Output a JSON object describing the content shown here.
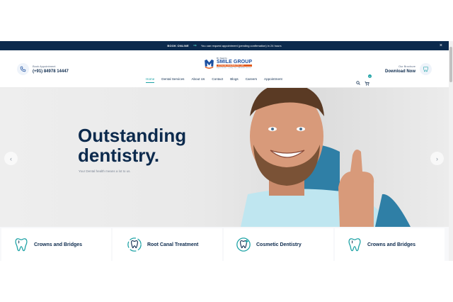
{
  "topbar": {
    "book_label": "BOOK ONLINE",
    "arrow": "⇒",
    "message": "You can request appointment (pending confirmation) in 24 hours",
    "close": "×"
  },
  "header": {
    "appointment": {
      "label": "Book Appointment",
      "phone": "(+91) 84978 14447"
    },
    "brochure": {
      "label": "Our Brochure",
      "link": "Download Now"
    },
    "logo": {
      "prefix": "Dr. Kaam's",
      "name": "SMILE GROUP",
      "sub": "of Dental Hospitals Pvt. Ltd.",
      "tagline": "Expert Doctors • Quality Care • Affordable Services"
    },
    "nav": [
      {
        "label": "Home",
        "active": true
      },
      {
        "label": "Dental Services",
        "active": false
      },
      {
        "label": "About Us",
        "active": false
      },
      {
        "label": "Contact",
        "active": false
      },
      {
        "label": "Blogs",
        "active": false
      },
      {
        "label": "Careers",
        "active": false
      },
      {
        "label": "Appointment",
        "active": false
      }
    ],
    "cart_count": "0",
    "icons": [
      "search-icon",
      "cart-icon",
      "phone-icon",
      "tooth-icon"
    ]
  },
  "hero": {
    "headline_line1": "Outstanding",
    "headline_line2": "dentistry.",
    "tagline": "Your Dental health means a lot to us.",
    "prev": "‹",
    "next": "›"
  },
  "services": [
    {
      "label": "Crowns and Bridges",
      "icon": "tooth-icon"
    },
    {
      "label": "Root Canal Treatment",
      "icon": "root-canal-icon"
    },
    {
      "label": "Cosmetic Dentistry",
      "icon": "cosmetic-tooth-icon"
    },
    {
      "label": "Crowns and Bridges",
      "icon": "tooth-icon"
    }
  ],
  "colors": {
    "navy": "#0c2a4d",
    "teal": "#1fa3a6",
    "orange": "#e25b1e"
  }
}
